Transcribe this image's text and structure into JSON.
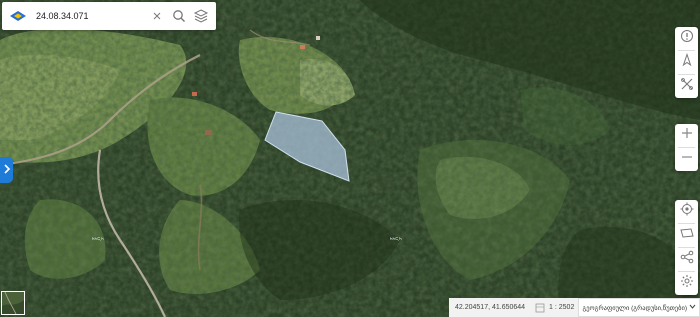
{
  "search": {
    "value": "24.08.34.071"
  },
  "status": {
    "coordinates": "42.204517, 41.650644",
    "scale": "1 : 2502",
    "layer": "გეოგრაფიული (გრადუსი,წუთები)"
  },
  "map": {
    "road_label_1": "ᏂᏂᏩᏂ",
    "road_label_2": "ᏂᏂᏩᏂ"
  },
  "colors": {
    "parcel_fill": "#a9c2db",
    "accent": "#1e7bd8",
    "logo_blue": "#2a6fcc",
    "logo_yellow": "#f5c400"
  },
  "icons": {
    "search_bar": [
      "logo-icon",
      "clear-icon",
      "search-icon",
      "layers-icon"
    ],
    "right_top": [
      "info-icon",
      "compass-icon",
      "measure-icon"
    ],
    "zoom": [
      "zoom-in-icon",
      "zoom-out-icon"
    ],
    "right_bottom": [
      "locate-icon",
      "draw-polygon-icon",
      "share-icon",
      "settings-icon"
    ],
    "toggle": "chevron-right-icon"
  }
}
